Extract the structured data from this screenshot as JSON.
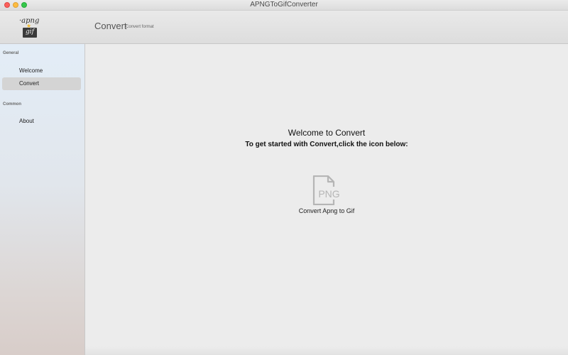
{
  "window": {
    "title": "APNGToGifConverter"
  },
  "header": {
    "logo": {
      "top_text": "·apng",
      "box_text": "gif"
    },
    "title": "Convert",
    "subtitle": "Convert format"
  },
  "sidebar": {
    "sections": [
      {
        "title": "General",
        "items": [
          {
            "label": "Welcome",
            "selected": false
          },
          {
            "label": "Convert",
            "selected": true
          }
        ]
      },
      {
        "title": "Common",
        "items": [
          {
            "label": "About",
            "selected": false
          }
        ]
      }
    ]
  },
  "main": {
    "welcome_title": "Welcome to Convert",
    "welcome_subtitle": "To get started with Convert,click the icon below:",
    "convert_tile": {
      "icon": "png-file-icon",
      "icon_text": "PNG",
      "label": "Convert Apng to Gif"
    }
  },
  "colors": {
    "close": "#fc605c",
    "minimize": "#fdbc40",
    "maximize": "#34c84a",
    "selected_item": "#d4d4d4",
    "icon_gray": "#b5b5b5"
  }
}
